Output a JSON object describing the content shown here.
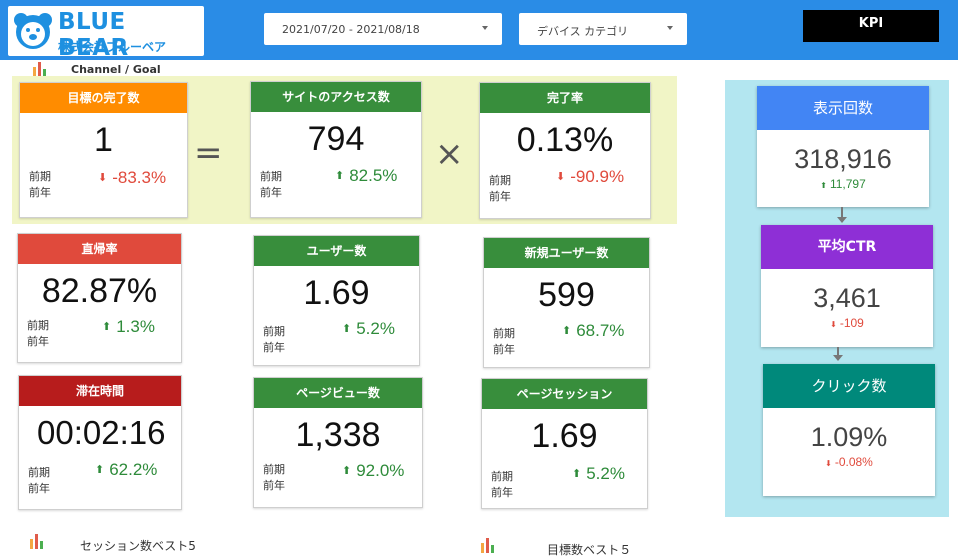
{
  "header": {
    "brand": "BLUE BEAR",
    "company": "株式会社ブルーベア",
    "date_range": "2021/07/20 - 2021/08/18",
    "device_category": "デバイス カテゴリ",
    "kpi_button": "KPI"
  },
  "sections": {
    "channel_goal": "Channel / Goal",
    "sessions_best5": "セッション数ベスト5",
    "goals_best5": "目標数ベスト５"
  },
  "labels": {
    "prev_period": "前期",
    "prev_year": "前年"
  },
  "operators": {
    "equals": "=",
    "times": "×"
  },
  "cards": {
    "goal_completions": {
      "title": "目標の完了数",
      "value": "1",
      "delta": "-83.3%"
    },
    "site_access": {
      "title": "サイトのアクセス数",
      "value": "794",
      "delta": "82.5%"
    },
    "completion_rate": {
      "title": "完了率",
      "value": "0.13%",
      "delta": "-90.9%"
    },
    "bounce_rate": {
      "title": "直帰率",
      "value": "82.87%",
      "delta": "1.3%"
    },
    "users": {
      "title": "ユーザー数",
      "value": "1.69",
      "delta": "5.2%"
    },
    "new_users": {
      "title": "新規ユーザー数",
      "value": "599",
      "delta": "68.7%"
    },
    "duration": {
      "title": "滞在時間",
      "value": "00:02:16",
      "delta": "62.2%"
    },
    "pageviews": {
      "title": "ページビュー数",
      "value": "1,338",
      "delta": "92.0%"
    },
    "page_session": {
      "title": "ページセッション",
      "value": "1.69",
      "delta": "5.2%"
    }
  },
  "kpi": {
    "impressions": {
      "title": "表示回数",
      "value": "318,916",
      "delta": "11,797"
    },
    "avg_ctr": {
      "title": "平均CTR",
      "value": "3,461",
      "delta": "-109"
    },
    "clicks": {
      "title": "クリック数",
      "value": "1.09%",
      "delta": "-0.08%"
    }
  },
  "colors": {
    "header_bg": "#2a8ce6",
    "orange": "#ff8c00",
    "green": "#388e3c",
    "red": "#e04a3c",
    "dark_red": "#b71c1c",
    "kpi_blue": "#4285f4",
    "kpi_purple": "#8e2fd6",
    "kpi_teal": "#00897b",
    "goal_band": "#f1f5c6",
    "kpi_panel": "#b3e6f0"
  }
}
